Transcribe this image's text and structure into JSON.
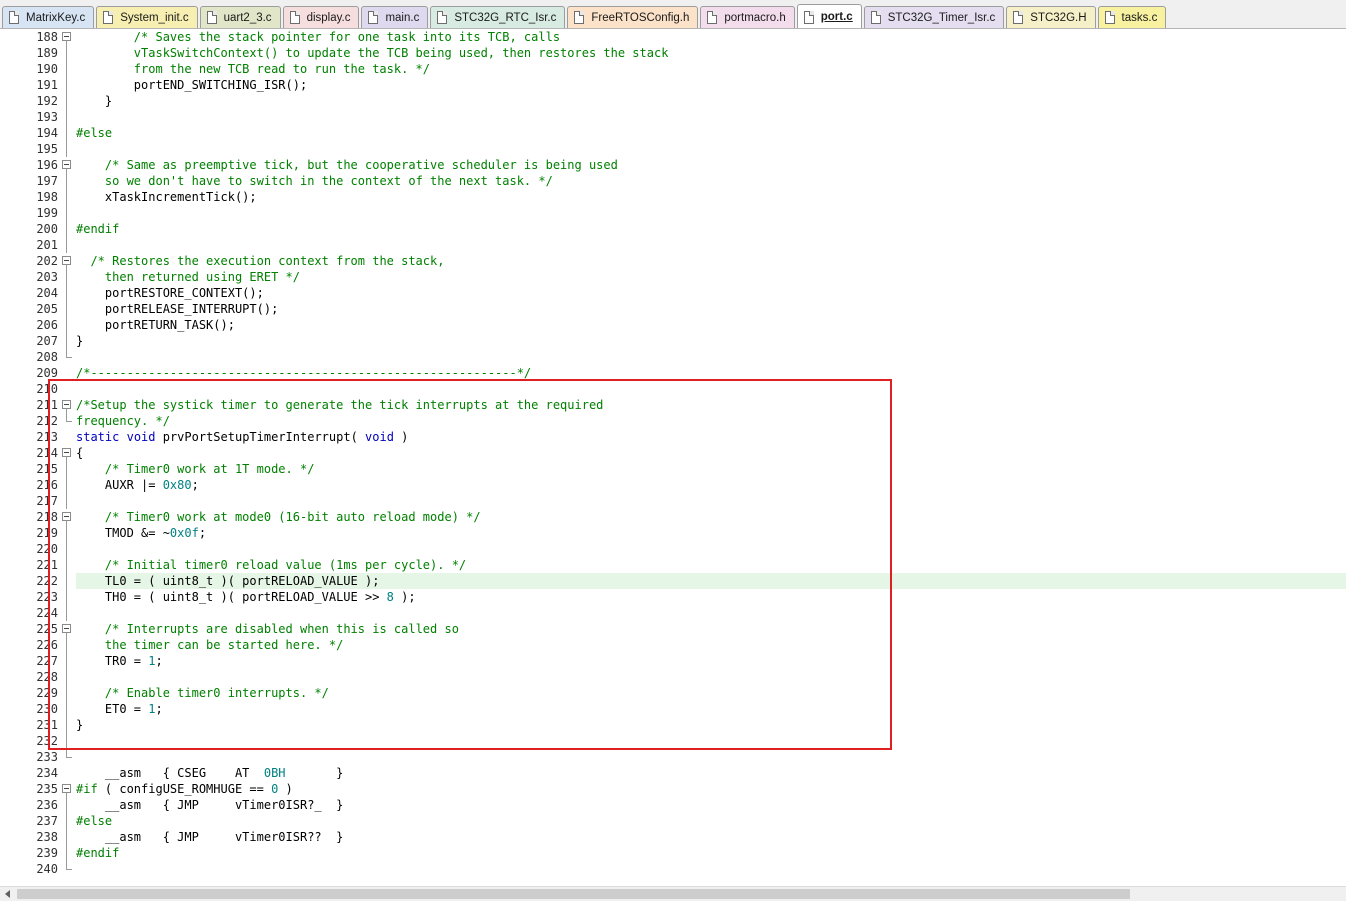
{
  "tabs": [
    {
      "label": "MatrixKey.c",
      "color": "#d6e4f4",
      "active": false
    },
    {
      "label": "System_init.c",
      "color": "#f7efb2",
      "active": false
    },
    {
      "label": "uart2_3.c",
      "color": "#e2e6c9",
      "active": false
    },
    {
      "label": "display.c",
      "color": "#f6dede",
      "active": false
    },
    {
      "label": "main.c",
      "color": "#ded9ee",
      "active": false
    },
    {
      "label": "STC32G_RTC_Isr.c",
      "color": "#d7ebe2",
      "active": false
    },
    {
      "label": "FreeRTOSConfig.h",
      "color": "#fbe2c8",
      "active": false
    },
    {
      "label": "portmacro.h",
      "color": "#f3dcec",
      "active": false
    },
    {
      "label": "port.c",
      "color": "#ffffff",
      "active": true
    },
    {
      "label": "STC32G_Timer_Isr.c",
      "color": "#e4def0",
      "active": false
    },
    {
      "label": "STC32G.H",
      "color": "#f5f0c8",
      "active": false
    },
    {
      "label": "tasks.c",
      "color": "#f7f1a0",
      "active": false
    }
  ],
  "lines": [
    {
      "n": "188",
      "fold": "open",
      "segs": [
        [
          "        ",
          ""
        ],
        [
          "/* Saves the stack pointer for one task into its TCB, calls",
          "cmt"
        ]
      ]
    },
    {
      "n": "189",
      "fold": "line",
      "segs": [
        [
          "        ",
          ""
        ],
        [
          "vTaskSwitchContext() to update the TCB being used, then restores the stack",
          "cmt"
        ]
      ]
    },
    {
      "n": "190",
      "fold": "line",
      "segs": [
        [
          "        ",
          ""
        ],
        [
          "from the new TCB read to run the task. */",
          "cmt"
        ]
      ]
    },
    {
      "n": "191",
      "fold": "line",
      "segs": [
        [
          "        portEND_SWITCHING_ISR();",
          ""
        ]
      ]
    },
    {
      "n": "192",
      "fold": "line",
      "segs": [
        [
          "    }",
          ""
        ]
      ]
    },
    {
      "n": "193",
      "fold": "line",
      "segs": [
        [
          "",
          ""
        ]
      ]
    },
    {
      "n": "194",
      "fold": "line",
      "segs": [
        [
          "#else",
          "pp"
        ]
      ]
    },
    {
      "n": "195",
      "fold": "line",
      "segs": [
        [
          "",
          ""
        ]
      ]
    },
    {
      "n": "196",
      "fold": "open",
      "segs": [
        [
          "    ",
          ""
        ],
        [
          "/* Same as preemptive tick, but the cooperative scheduler is being used",
          "cmt"
        ]
      ]
    },
    {
      "n": "197",
      "fold": "line",
      "segs": [
        [
          "    ",
          ""
        ],
        [
          "so we don't have to switch in the context of the next task. */",
          "cmt"
        ]
      ]
    },
    {
      "n": "198",
      "fold": "line",
      "segs": [
        [
          "    xTaskIncrementTick();",
          ""
        ]
      ]
    },
    {
      "n": "199",
      "fold": "line",
      "segs": [
        [
          "",
          ""
        ]
      ]
    },
    {
      "n": "200",
      "fold": "line",
      "segs": [
        [
          "#endif",
          "pp"
        ]
      ]
    },
    {
      "n": "201",
      "fold": "line",
      "segs": [
        [
          "",
          ""
        ]
      ]
    },
    {
      "n": "202",
      "fold": "open",
      "segs": [
        [
          "  ",
          ""
        ],
        [
          "/* Restores the execution context from the stack,",
          "cmt"
        ]
      ]
    },
    {
      "n": "203",
      "fold": "line",
      "segs": [
        [
          "    ",
          ""
        ],
        [
          "then returned using ERET */",
          "cmt"
        ]
      ]
    },
    {
      "n": "204",
      "fold": "line",
      "segs": [
        [
          "    portRESTORE_CONTEXT();",
          ""
        ]
      ]
    },
    {
      "n": "205",
      "fold": "line",
      "segs": [
        [
          "    portRELEASE_INTERRUPT();",
          ""
        ]
      ]
    },
    {
      "n": "206",
      "fold": "line",
      "segs": [
        [
          "    portRETURN_TASK();",
          ""
        ]
      ]
    },
    {
      "n": "207",
      "fold": "line",
      "segs": [
        [
          "}",
          ""
        ]
      ]
    },
    {
      "n": "208",
      "fold": "end",
      "segs": [
        [
          "",
          ""
        ]
      ]
    },
    {
      "n": "209",
      "fold": "",
      "segs": [
        [
          "/*-----------------------------------------------------------*/",
          "cmt"
        ]
      ]
    },
    {
      "n": "210",
      "fold": "",
      "segs": [
        [
          "",
          ""
        ]
      ]
    },
    {
      "n": "211",
      "fold": "open",
      "segs": [
        [
          "/*Setup the systick timer to generate the tick interrupts at the required",
          "cmt"
        ]
      ]
    },
    {
      "n": "212",
      "fold": "end",
      "segs": [
        [
          "frequency. */",
          "cmt"
        ]
      ]
    },
    {
      "n": "213",
      "fold": "",
      "segs": [
        [
          "static",
          "kw"
        ],
        [
          " ",
          ""
        ],
        [
          "void",
          "kw"
        ],
        [
          " prvPortSetupTimerInterrupt( ",
          ""
        ],
        [
          "void",
          "kw"
        ],
        [
          " )",
          ""
        ]
      ]
    },
    {
      "n": "214",
      "fold": "open",
      "segs": [
        [
          "{",
          ""
        ]
      ]
    },
    {
      "n": "215",
      "fold": "line",
      "segs": [
        [
          "    ",
          ""
        ],
        [
          "/* Timer0 work at 1T mode. */",
          "cmt"
        ]
      ]
    },
    {
      "n": "216",
      "fold": "line",
      "segs": [
        [
          "    AUXR |= ",
          ""
        ],
        [
          "0x80",
          "num"
        ],
        [
          ";",
          ""
        ]
      ]
    },
    {
      "n": "217",
      "fold": "line",
      "segs": [
        [
          "",
          ""
        ]
      ]
    },
    {
      "n": "218",
      "fold": "open",
      "segs": [
        [
          "    ",
          ""
        ],
        [
          "/* Timer0 work at mode0 (16-bit auto reload mode) */",
          "cmt"
        ]
      ]
    },
    {
      "n": "219",
      "fold": "line",
      "segs": [
        [
          "    TMOD &= ~",
          ""
        ],
        [
          "0x0f",
          "num"
        ],
        [
          ";",
          ""
        ]
      ]
    },
    {
      "n": "220",
      "fold": "line",
      "segs": [
        [
          "",
          ""
        ]
      ]
    },
    {
      "n": "221",
      "fold": "line",
      "segs": [
        [
          "    ",
          ""
        ],
        [
          "/* Initial timer0 reload value (1ms per cycle). */",
          "cmt"
        ]
      ]
    },
    {
      "n": "222",
      "fold": "line",
      "current": true,
      "segs": [
        [
          "    TL0 = ( uint8_t )( portRELOAD_VALUE );",
          ""
        ]
      ]
    },
    {
      "n": "223",
      "fold": "line",
      "segs": [
        [
          "    TH0 = ( uint8_t )( portRELOAD_VALUE >> ",
          ""
        ],
        [
          "8",
          "num"
        ],
        [
          " );",
          ""
        ]
      ]
    },
    {
      "n": "224",
      "fold": "line",
      "segs": [
        [
          "",
          ""
        ]
      ]
    },
    {
      "n": "225",
      "fold": "open",
      "segs": [
        [
          "    ",
          ""
        ],
        [
          "/* Interrupts are disabled when this is called so",
          "cmt"
        ]
      ]
    },
    {
      "n": "226",
      "fold": "line",
      "segs": [
        [
          "    ",
          ""
        ],
        [
          "the timer can be started here. */",
          "cmt"
        ]
      ]
    },
    {
      "n": "227",
      "fold": "line",
      "segs": [
        [
          "    TR0 = ",
          ""
        ],
        [
          "1",
          "num"
        ],
        [
          ";",
          ""
        ]
      ]
    },
    {
      "n": "228",
      "fold": "line",
      "segs": [
        [
          "",
          ""
        ]
      ]
    },
    {
      "n": "229",
      "fold": "line",
      "segs": [
        [
          "    ",
          ""
        ],
        [
          "/* Enable timer0 interrupts. */",
          "cmt"
        ]
      ]
    },
    {
      "n": "230",
      "fold": "line",
      "segs": [
        [
          "    ET0 = ",
          ""
        ],
        [
          "1",
          "num"
        ],
        [
          ";",
          ""
        ]
      ]
    },
    {
      "n": "231",
      "fold": "line",
      "segs": [
        [
          "}",
          ""
        ]
      ]
    },
    {
      "n": "232",
      "fold": "line",
      "segs": [
        [
          "",
          ""
        ]
      ]
    },
    {
      "n": "233",
      "fold": "end",
      "segs": [
        [
          "",
          ""
        ]
      ]
    },
    {
      "n": "234",
      "fold": "",
      "segs": [
        [
          "    __asm   { CSEG    AT  ",
          ""
        ],
        [
          "0BH",
          "num"
        ],
        [
          "       }",
          ""
        ]
      ]
    },
    {
      "n": "235",
      "fold": "open",
      "segs": [
        [
          "#if",
          "pp"
        ],
        [
          " ( configUSE_ROMHUGE == ",
          ""
        ],
        [
          "0",
          "num"
        ],
        [
          " )",
          ""
        ]
      ]
    },
    {
      "n": "236",
      "fold": "line",
      "segs": [
        [
          "    __asm   { JMP     vTimer0ISR?_  }",
          ""
        ]
      ]
    },
    {
      "n": "237",
      "fold": "line",
      "segs": [
        [
          "#else",
          "pp"
        ]
      ]
    },
    {
      "n": "238",
      "fold": "line",
      "segs": [
        [
          "    __asm   { JMP     vTimer0ISR??  }",
          ""
        ]
      ]
    },
    {
      "n": "239",
      "fold": "line",
      "segs": [
        [
          "#endif",
          "pp"
        ]
      ]
    },
    {
      "n": "240",
      "fold": "end",
      "segs": [
        [
          "",
          ""
        ]
      ]
    }
  ],
  "colors": {
    "comment": "#008000",
    "keyword": "#0000c0",
    "number": "#008080",
    "highlight_box": "#e02020",
    "current_line": "#e6f6e6"
  }
}
